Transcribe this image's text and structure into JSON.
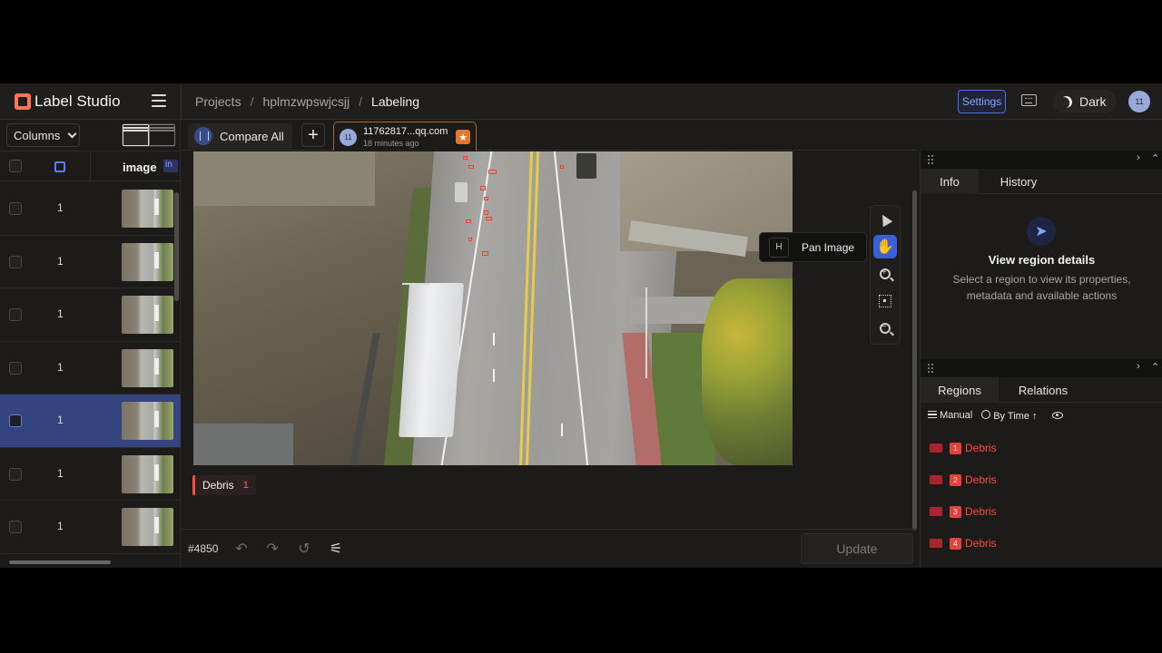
{
  "app": {
    "name": "Label Studio"
  },
  "breadcrumbs": [
    "Projects",
    "hplmzwpswjcsjj",
    "Labeling"
  ],
  "header": {
    "settings_label": "Settings",
    "theme_label": "Dark",
    "user_initials": "11"
  },
  "left_panel": {
    "columns_label": "Columns",
    "column_header": "image",
    "column_badge": "in",
    "rows": [
      {
        "value": "1",
        "selected": false
      },
      {
        "value": "1",
        "selected": false
      },
      {
        "value": "1",
        "selected": false
      },
      {
        "value": "1",
        "selected": false
      },
      {
        "value": "1",
        "selected": true
      },
      {
        "value": "1",
        "selected": false
      },
      {
        "value": "1",
        "selected": false
      }
    ]
  },
  "tabs": {
    "compare_label": "Compare All",
    "annotation": {
      "avatar": "11",
      "email": "11762817...qq.com",
      "time": "18 minutes ago"
    }
  },
  "canvas": {
    "tooltip_key": "H",
    "tooltip_label": "Pan Image",
    "active_tool": "pan"
  },
  "labels": {
    "name": "Debris",
    "count": "1",
    "color": "#ff4a3d"
  },
  "bottom": {
    "task_id": "#4850",
    "update_label": "Update"
  },
  "info_panel": {
    "tabs": [
      "Info",
      "History"
    ],
    "title": "View region details",
    "description": "Select a region to view its properties, metadata and available actions"
  },
  "regions_panel": {
    "tabs": [
      "Regions",
      "Relations"
    ],
    "sort_manual": "Manual",
    "sort_time": "By Time",
    "items": [
      {
        "index": "1",
        "label": "Debris"
      },
      {
        "index": "2",
        "label": "Debris"
      },
      {
        "index": "3",
        "label": "Debris"
      },
      {
        "index": "4",
        "label": "Debris"
      }
    ]
  },
  "colors": {
    "accent": "#3b5fd6",
    "region": "#ff4a3d",
    "background": "#1c1b1a"
  }
}
